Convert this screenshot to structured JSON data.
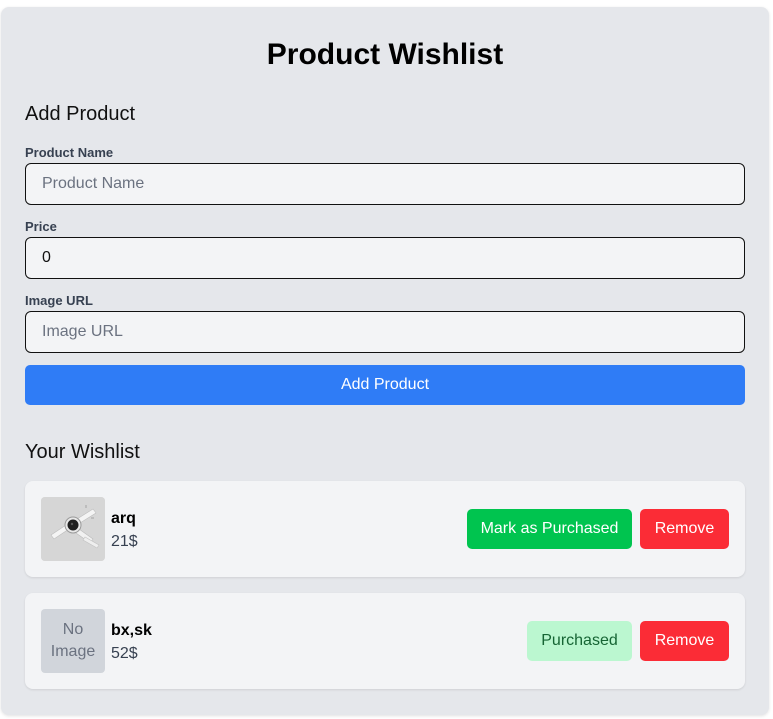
{
  "app": {
    "title": "Product Wishlist"
  },
  "form": {
    "heading": "Add Product",
    "name_label": "Product Name",
    "name_placeholder": "Product Name",
    "name_value": "",
    "price_label": "Price",
    "price_value": "0",
    "image_label": "Image URL",
    "image_placeholder": "Image URL",
    "image_value": "",
    "submit_label": "Add Product"
  },
  "wishlist": {
    "heading": "Your Wishlist",
    "items": [
      {
        "name": "arq",
        "price": "21$",
        "image": "smartwatch-photo",
        "purchased": false,
        "action_label": "Mark as Purchased",
        "remove_label": "Remove"
      },
      {
        "name": "bx,sk",
        "price": "52$",
        "image_placeholder_line1": "No",
        "image_placeholder_line2": "Image",
        "purchased": true,
        "action_label": "Purchased",
        "remove_label": "Remove"
      }
    ]
  },
  "colors": {
    "primary": "#2f7cf6",
    "success": "#00c44f",
    "success_light": "#bbf7d0",
    "danger": "#fb2c36",
    "panel": "#e5e7eb",
    "card": "#f3f4f6"
  }
}
